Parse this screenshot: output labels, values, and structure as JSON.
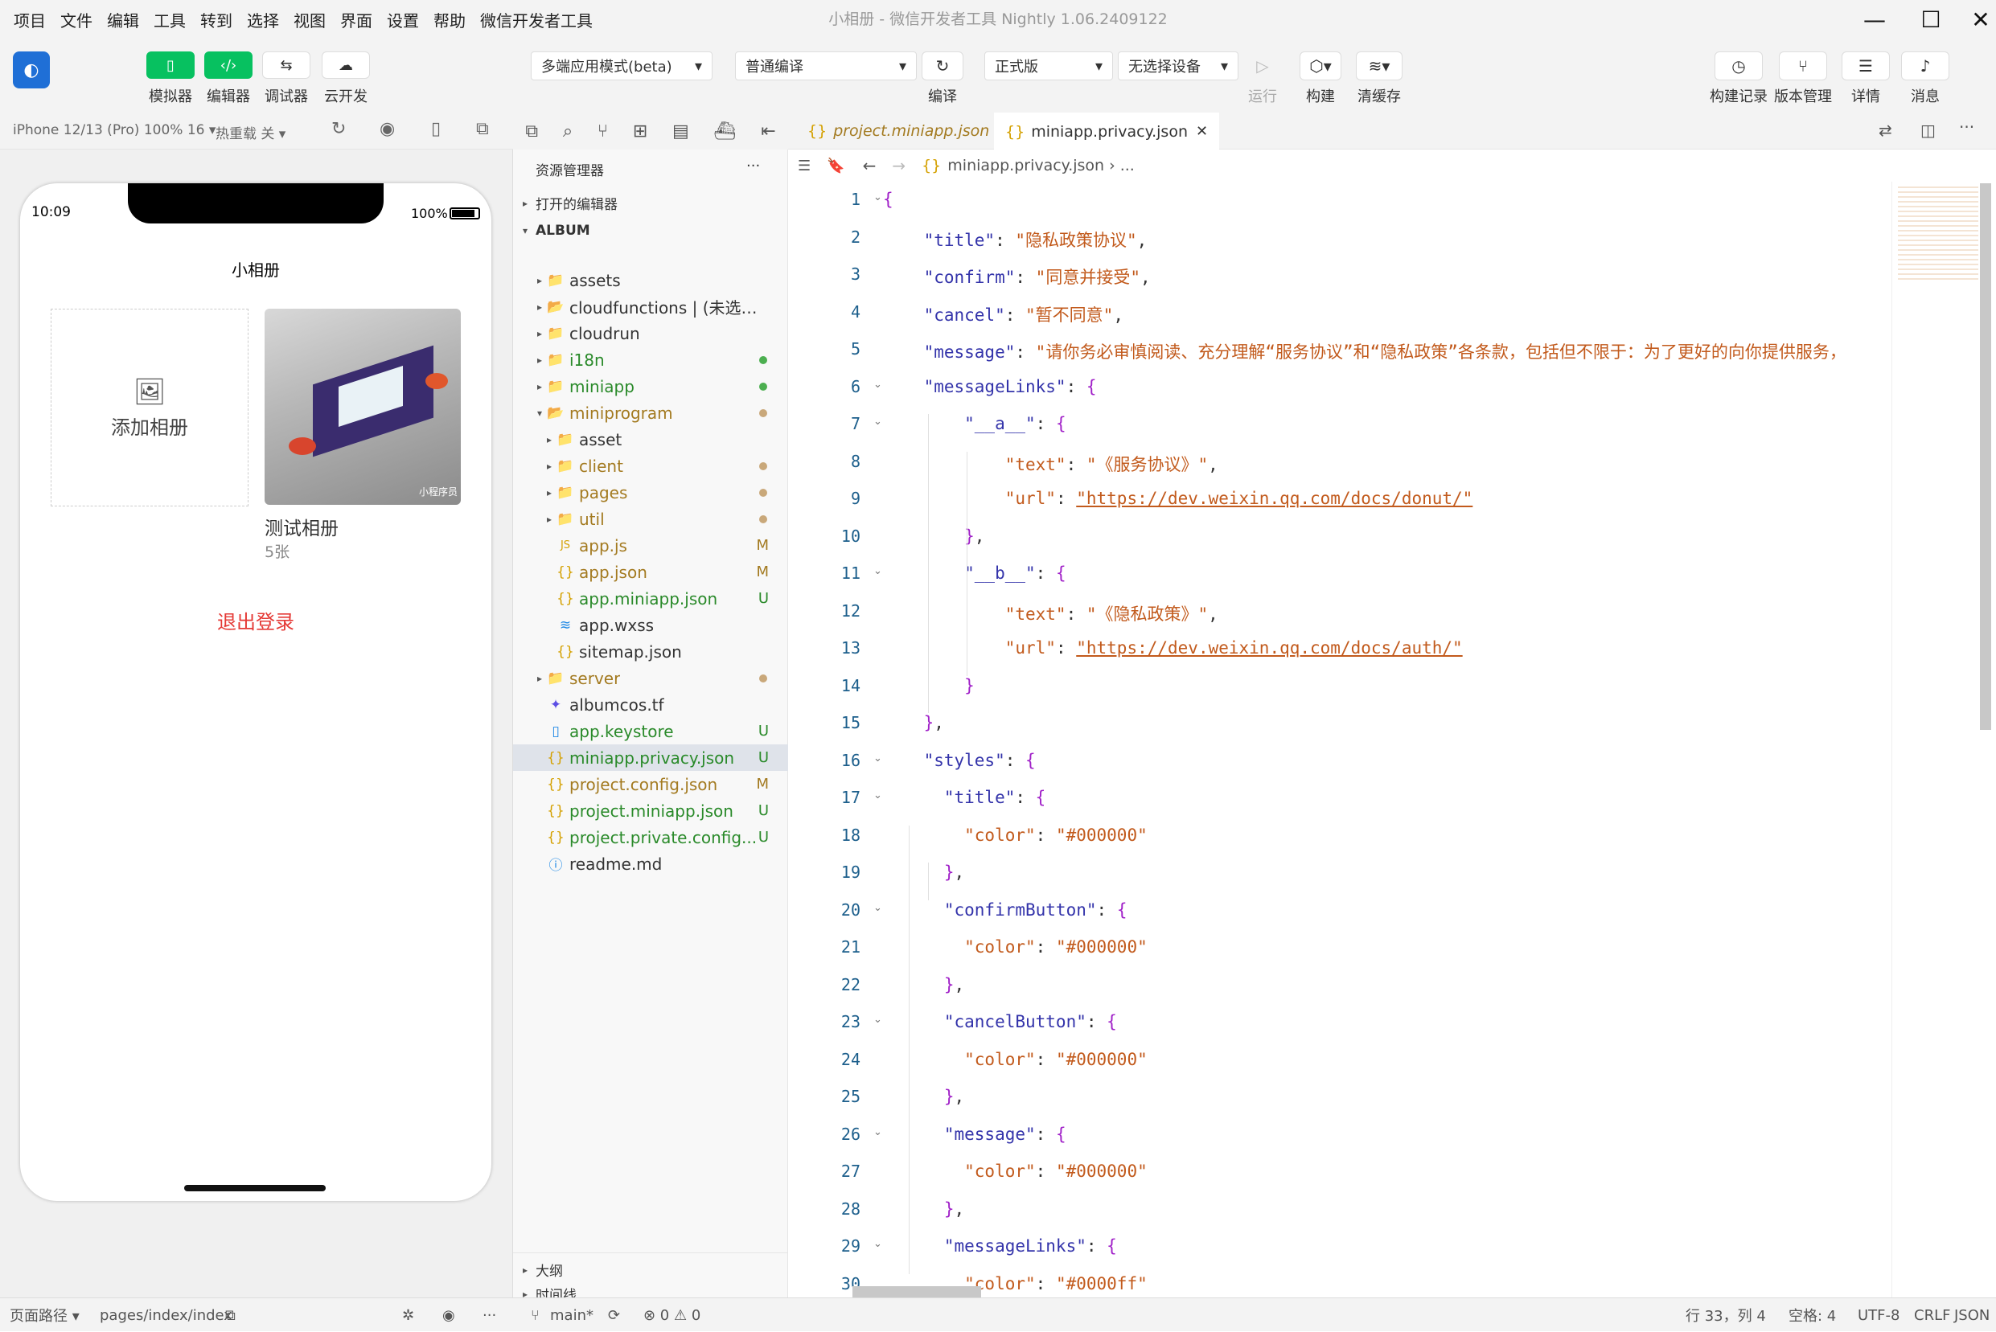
{
  "menu": [
    "项目",
    "文件",
    "编辑",
    "工具",
    "转到",
    "选择",
    "视图",
    "界面",
    "设置",
    "帮助",
    "微信开发者工具"
  ],
  "window_title": "小相册 - 微信开发者工具 Nightly 1.06.2409122",
  "toolbar": {
    "simulator": "模拟器",
    "editor": "编辑器",
    "debugger": "调试器",
    "cloud": "云开发",
    "mode_select": "多端应用模式(beta)",
    "compile_select": "普通编译",
    "compile_label": "编译",
    "version_select": "正式版",
    "device_select": "无选择设备",
    "run": "运行",
    "build": "构建",
    "clear_cache": "清缓存",
    "build_log": "构建记录",
    "version_mgmt": "版本管理",
    "details": "详情",
    "messages": "消息"
  },
  "simbar": {
    "device": "iPhone 12/13 (Pro) 100% 16 ▾",
    "hot_reload": "热重载 关 ▾"
  },
  "phone": {
    "time": "10:09",
    "battery": "100%",
    "nav_title": "小相册",
    "add_album": "添加相册",
    "album_name": "测试相册",
    "album_count": "5张",
    "logout": "退出登录",
    "watermark": "小程序员"
  },
  "explorer": {
    "title": "资源管理器",
    "more": "···",
    "open_editors": "打开的编辑器",
    "root": "ALBUM",
    "outline": "大纲",
    "timeline": "时间线",
    "items": [
      {
        "label": "assets",
        "chev": "▸",
        "icon": "📁",
        "color": "#333",
        "stat": "",
        "dot": ""
      },
      {
        "label": "cloudfunctions | (未选择...",
        "chev": "▸",
        "icon": "📂",
        "color": "#333",
        "stat": "",
        "dot": ""
      },
      {
        "label": "cloudrun",
        "chev": "▸",
        "icon": "📁",
        "color": "#333",
        "stat": "",
        "dot": ""
      },
      {
        "label": "i18n",
        "chev": "▸",
        "icon": "📁",
        "color": "#2a8a2a",
        "stat": "",
        "dot": "#4caf50"
      },
      {
        "label": "miniapp",
        "chev": "▸",
        "icon": "📁",
        "color": "#2a8a2a",
        "stat": "",
        "dot": "#4caf50"
      },
      {
        "label": "miniprogram",
        "chev": "▾",
        "icon": "📂",
        "color": "#a37a20",
        "stat": "",
        "dot": "#c9a87a"
      },
      {
        "label": "asset",
        "chev": "▸",
        "icon": "📁",
        "color": "#333",
        "stat": "",
        "dot": ""
      },
      {
        "label": "client",
        "chev": "▸",
        "icon": "📁",
        "color": "#a37a20",
        "stat": "",
        "dot": "#c9a87a"
      },
      {
        "label": "pages",
        "chev": "▸",
        "icon": "📁",
        "color": "#a37a20",
        "stat": "",
        "dot": "#c9a87a"
      },
      {
        "label": "util",
        "chev": "▸",
        "icon": "📁",
        "color": "#a37a20",
        "stat": "",
        "dot": "#c9a87a"
      },
      {
        "label": "app.js",
        "chev": "",
        "icon": "JS",
        "color": "#a37a20",
        "stat": "M",
        "dot": ""
      },
      {
        "label": "app.json",
        "chev": "",
        "icon": "{}",
        "color": "#a37a20",
        "stat": "M",
        "dot": ""
      },
      {
        "label": "app.miniapp.json",
        "chev": "",
        "icon": "{}",
        "color": "#2a8a2a",
        "stat": "U",
        "dot": ""
      },
      {
        "label": "app.wxss",
        "chev": "",
        "icon": "≋",
        "color": "#333",
        "stat": "",
        "dot": ""
      },
      {
        "label": "sitemap.json",
        "chev": "",
        "icon": "{}",
        "color": "#333",
        "stat": "",
        "dot": ""
      },
      {
        "label": "server",
        "chev": "▸",
        "icon": "📁",
        "color": "#a37a20",
        "stat": "",
        "dot": "#c9a87a"
      },
      {
        "label": "albumcos.tf",
        "chev": "",
        "icon": "✦",
        "color": "#333",
        "stat": "",
        "dot": ""
      },
      {
        "label": "app.keystore",
        "chev": "",
        "icon": "▯",
        "color": "#2a8a2a",
        "stat": "U",
        "dot": ""
      },
      {
        "label": "miniapp.privacy.json",
        "chev": "",
        "icon": "{}",
        "color": "#2a8a2a",
        "stat": "U",
        "dot": ""
      },
      {
        "label": "project.config.json",
        "chev": "",
        "icon": "{}",
        "color": "#a37a20",
        "stat": "M",
        "dot": ""
      },
      {
        "label": "project.miniapp.json",
        "chev": "",
        "icon": "{}",
        "color": "#2a8a2a",
        "stat": "U",
        "dot": ""
      },
      {
        "label": "project.private.config...",
        "chev": "",
        "icon": "{}",
        "color": "#2a8a2a",
        "stat": "U",
        "dot": ""
      },
      {
        "label": "readme.md",
        "chev": "",
        "icon": "ⓘ",
        "color": "#333",
        "stat": "",
        "dot": ""
      }
    ]
  },
  "editor": {
    "tabs": [
      "project.miniapp.json",
      "miniapp.privacy.json"
    ],
    "breadcrumb_file": "miniapp.privacy.json",
    "breadcrumb_more": "...",
    "lines": [
      [
        "b:{"
      ],
      [
        "k:    \"title\"",
        "p:: ",
        "s:\"隐私政策协议\"",
        "p:,"
      ],
      [
        "k:    \"confirm\"",
        "p:: ",
        "s:\"同意并接受\"",
        "p:,"
      ],
      [
        "k:    \"cancel\"",
        "p:: ",
        "s:\"暂不同意\"",
        "p:,"
      ],
      [
        "k:    \"message\"",
        "p:: ",
        "s:\"请你务必审慎阅读、充分理解“服务协议”和“隐私政策”各条款，包括但不限于：为了更好的向你提供服务，"
      ],
      [
        "k:    \"messageLinks\"",
        "p:: ",
        "b:{"
      ],
      [
        "k:        \"__a__\"",
        "p:: ",
        "b:{"
      ],
      [
        "s:            \"text\"",
        "p:: ",
        "s:\"《服务协议》\"",
        "p:,"
      ],
      [
        "s:            \"url\"",
        "p:: ",
        "u:\"https://dev.weixin.qq.com/docs/donut/\""
      ],
      [
        "b:        }",
        "p:,"
      ],
      [
        "k:        \"__b__\"",
        "p:: ",
        "b:{"
      ],
      [
        "s:            \"text\"",
        "p:: ",
        "s:\"《隐私政策》\"",
        "p:,"
      ],
      [
        "s:            \"url\"",
        "p:: ",
        "u:\"https://dev.weixin.qq.com/docs/auth/\""
      ],
      [
        "b:        }"
      ],
      [
        "b:    }",
        "p:,"
      ],
      [
        "k:    \"styles\"",
        "p:: ",
        "b:{"
      ],
      [
        "k:      \"title\"",
        "p:: ",
        "b:{"
      ],
      [
        "s:        \"color\"",
        "p:: ",
        "s:\"#000000\""
      ],
      [
        "b:      }",
        "p:,"
      ],
      [
        "k:      \"confirmButton\"",
        "p:: ",
        "b:{"
      ],
      [
        "s:        \"color\"",
        "p:: ",
        "s:\"#000000\""
      ],
      [
        "b:      }",
        "p:,"
      ],
      [
        "k:      \"cancelButton\"",
        "p:: ",
        "b:{"
      ],
      [
        "s:        \"color\"",
        "p:: ",
        "s:\"#000000\""
      ],
      [
        "b:      }",
        "p:,"
      ],
      [
        "k:      \"message\"",
        "p:: ",
        "b:{"
      ],
      [
        "s:        \"color\"",
        "p:: ",
        "s:\"#000000\""
      ],
      [
        "b:      }",
        "p:,"
      ],
      [
        "k:      \"messageLinks\"",
        "p:: ",
        "b:{"
      ],
      [
        "s:        \"color\"",
        "p:: ",
        "s:\"#0000ff\""
      ]
    ],
    "folds": [
      1,
      6,
      7,
      11,
      16,
      17,
      20,
      23,
      26,
      29
    ]
  },
  "status": {
    "page_path_label": "页面路径 ▾",
    "page_path": "pages/index/index",
    "branch": "main*",
    "problems": "⊗ 0 ⚠ 0",
    "cursor": "行 33，列 4",
    "spaces": "空格: 4",
    "encoding": "UTF-8",
    "eol": "CRLF",
    "language": "JSON"
  }
}
